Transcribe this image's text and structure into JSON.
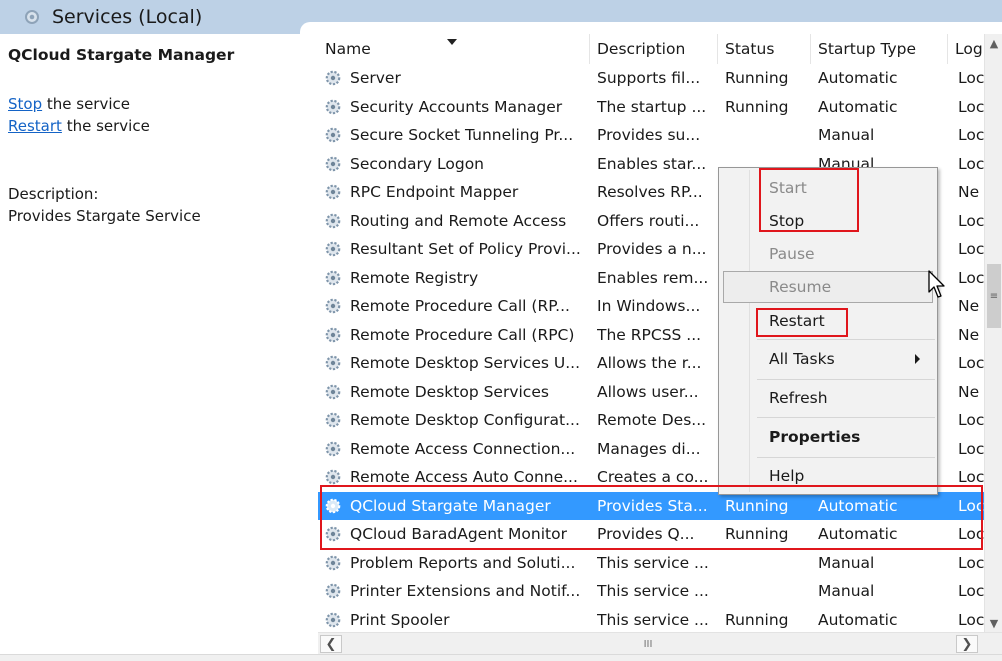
{
  "header": {
    "title": "Services (Local)",
    "icon": "services-icon"
  },
  "left_pane": {
    "service_name": "QCloud Stargate Manager",
    "stop_link": "Stop",
    "stop_suffix": " the service",
    "restart_link": "Restart",
    "restart_suffix": " the service",
    "description_label": "Description:",
    "description_text": "Provides Stargate Service"
  },
  "columns": {
    "name": "Name",
    "description": "Description",
    "status": "Status",
    "startup_type": "Startup Type",
    "log_on_as": "Log"
  },
  "rows": [
    {
      "name": "Server",
      "desc": "Supports fil...",
      "status": "Running",
      "startup": "Automatic",
      "log": "Loc"
    },
    {
      "name": "Security Accounts Manager",
      "desc": "The startup ...",
      "status": "Running",
      "startup": "Automatic",
      "log": "Loc"
    },
    {
      "name": "Secure Socket Tunneling Pr...",
      "desc": "Provides su...",
      "status": "",
      "startup": "Manual",
      "log": "Loc"
    },
    {
      "name": "Secondary Logon",
      "desc": "Enables star...",
      "status": "",
      "startup": "Manual",
      "log": "Loc"
    },
    {
      "name": "RPC Endpoint Mapper",
      "desc": "Resolves RP...",
      "status": "",
      "startup": "",
      "log": "Ne"
    },
    {
      "name": "Routing and Remote Access",
      "desc": "Offers routi...",
      "status": "",
      "startup": "",
      "log": "Loc"
    },
    {
      "name": "Resultant Set of Policy Provi...",
      "desc": "Provides a n...",
      "status": "",
      "startup": "",
      "log": "Loc"
    },
    {
      "name": "Remote Registry",
      "desc": "Enables rem...",
      "status": "",
      "startup": "",
      "log": "Loc"
    },
    {
      "name": "Remote Procedure Call (RP...",
      "desc": "In Windows...",
      "status": "",
      "startup": "",
      "log": "Ne"
    },
    {
      "name": "Remote Procedure Call (RPC)",
      "desc": "The RPCSS ...",
      "status": "",
      "startup": "",
      "log": "Ne"
    },
    {
      "name": "Remote Desktop Services U...",
      "desc": "Allows the r...",
      "status": "",
      "startup": "",
      "log": "Loc"
    },
    {
      "name": "Remote Desktop Services",
      "desc": "Allows user...",
      "status": "",
      "startup": "",
      "log": "Ne"
    },
    {
      "name": "Remote Desktop Configurat...",
      "desc": "Remote Des...",
      "status": "",
      "startup": "",
      "log": "Loc"
    },
    {
      "name": "Remote Access Connection...",
      "desc": "Manages di...",
      "status": "",
      "startup": "",
      "log": "Loc"
    },
    {
      "name": "Remote Access Auto Conne...",
      "desc": "Creates a co...",
      "status": "",
      "startup": "",
      "log": "Loc"
    },
    {
      "name": "QCloud Stargate Manager",
      "desc": "Provides Sta...",
      "status": "Running",
      "startup": "Automatic",
      "log": "Loc",
      "selected": true
    },
    {
      "name": "QCloud BaradAgent Monitor",
      "desc": "Provides Q...",
      "status": "Running",
      "startup": "Automatic",
      "log": "Loc"
    },
    {
      "name": "Problem Reports and Soluti...",
      "desc": "This service ...",
      "status": "",
      "startup": "Manual",
      "log": "Loc"
    },
    {
      "name": "Printer Extensions and Notif...",
      "desc": "This service ...",
      "status": "",
      "startup": "Manual",
      "log": "Loc"
    },
    {
      "name": "Print Spooler",
      "desc": "This service ...",
      "status": "Running",
      "startup": "Automatic",
      "log": "Loc"
    }
  ],
  "context_menu": {
    "start": "Start",
    "stop": "Stop",
    "pause": "Pause",
    "resume": "Resume",
    "restart": "Restart",
    "all_tasks": "All Tasks",
    "refresh": "Refresh",
    "properties": "Properties",
    "help": "Help"
  },
  "scrollbar": {
    "h_thumb_glyph": "III",
    "v_thumb_glyph": "≡"
  },
  "colors": {
    "header_bg": "#bdd1e6",
    "selection": "#3399ff",
    "link": "#1463c6",
    "annotation_red": "#e0161c"
  }
}
